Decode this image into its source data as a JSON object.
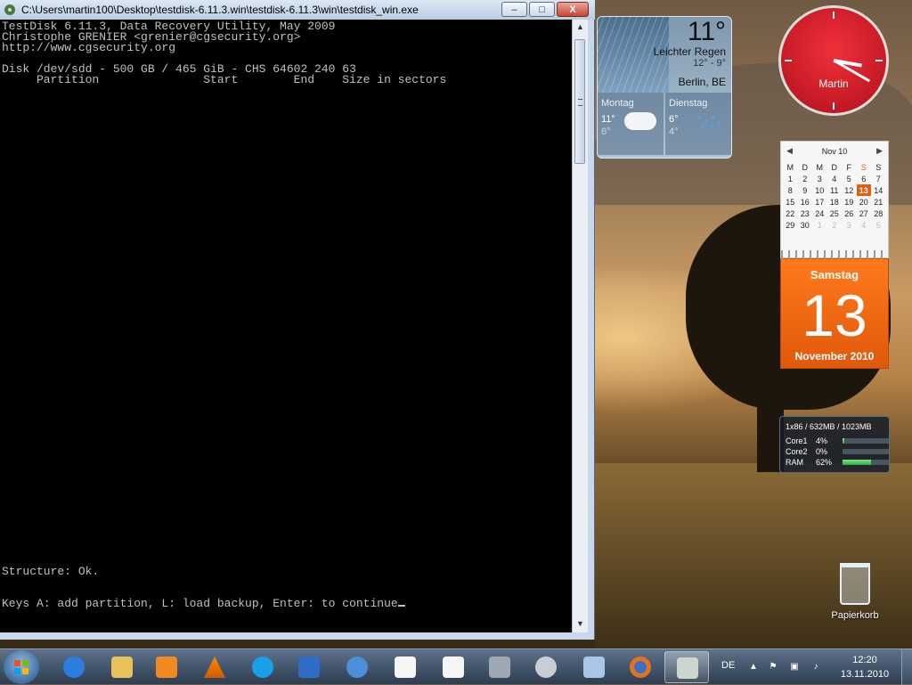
{
  "console": {
    "title": "C:\\Users\\martin100\\Desktop\\testdisk-6.11.3.win\\testdisk-6.11.3\\win\\testdisk_win.exe",
    "buttons": {
      "minimize": "–",
      "maximize": "□",
      "close": "X"
    },
    "lines": {
      "l1": "TestDisk 6.11.3, Data Recovery Utility, May 2009",
      "l2": "Christophe GRENIER <grenier@cgsecurity.org>",
      "l3": "http://www.cgsecurity.org",
      "l4": "Disk /dev/sdd - 500 GB / 465 GiB - CHS 64602 240 63",
      "l5": "     Partition               Start        End    Size in sectors",
      "structure": "Structure: Ok.",
      "keys": "Keys A: add partition, L: load backup, Enter: to continue"
    }
  },
  "weather": {
    "temp": "11°",
    "desc": "Leichter Regen",
    "range": "12° - 9°",
    "city": "Berlin, BE",
    "forecast": [
      {
        "day": "Montag",
        "hi": "11°",
        "lo": "6°",
        "icon": "cloud-icon"
      },
      {
        "day": "Dienstag",
        "hi": "6°",
        "lo": "4°",
        "icon": "rain-icon"
      }
    ]
  },
  "clock": {
    "label": "Martin",
    "hour": 3,
    "minute": 20
  },
  "calendar": {
    "month": "Nov 10",
    "weekdays": [
      "M",
      "D",
      "M",
      "D",
      "F",
      "S",
      "S"
    ],
    "weeks": [
      [
        "1",
        "2",
        "3",
        "4",
        "5",
        "6",
        "7"
      ],
      [
        "8",
        "9",
        "10",
        "11",
        "12",
        "13",
        "14"
      ],
      [
        "15",
        "16",
        "17",
        "18",
        "19",
        "20",
        "21"
      ],
      [
        "22",
        "23",
        "24",
        "25",
        "26",
        "27",
        "28"
      ],
      [
        "29",
        "30",
        "1",
        "2",
        "3",
        "4",
        "5"
      ]
    ],
    "today": "13",
    "big": {
      "weekday": "Samstag",
      "day": "13",
      "month_year": "November 2010"
    }
  },
  "meter": {
    "header": "1x86 / 632MB / 1023MB",
    "rows": [
      {
        "name": "Core1",
        "pct": "4%",
        "value": 0.04
      },
      {
        "name": "Core2",
        "pct": "0%",
        "value": 0.0
      },
      {
        "name": "RAM",
        "pct": "62%",
        "value": 0.62
      }
    ]
  },
  "desktop": {
    "recycle_bin": "Papierkorb"
  },
  "taskbar": {
    "items": [
      "internet-explorer-icon",
      "explorer-icon",
      "media-player-icon",
      "vlc-icon",
      "skype-icon",
      "network-icon",
      "thunderbird-icon",
      "document-icon",
      "document-icon",
      "wintv-icon",
      "satellite-icon",
      "network-share-icon",
      "firefox-icon",
      "testdisk-icon"
    ],
    "language": "DE",
    "time": "12:20",
    "date": "13.11.2010"
  },
  "colors": {
    "console_bg": "#000000",
    "console_fg": "#c0c0c0",
    "clock": "#d81e2a",
    "calendar_accent": "#e45c0c"
  }
}
